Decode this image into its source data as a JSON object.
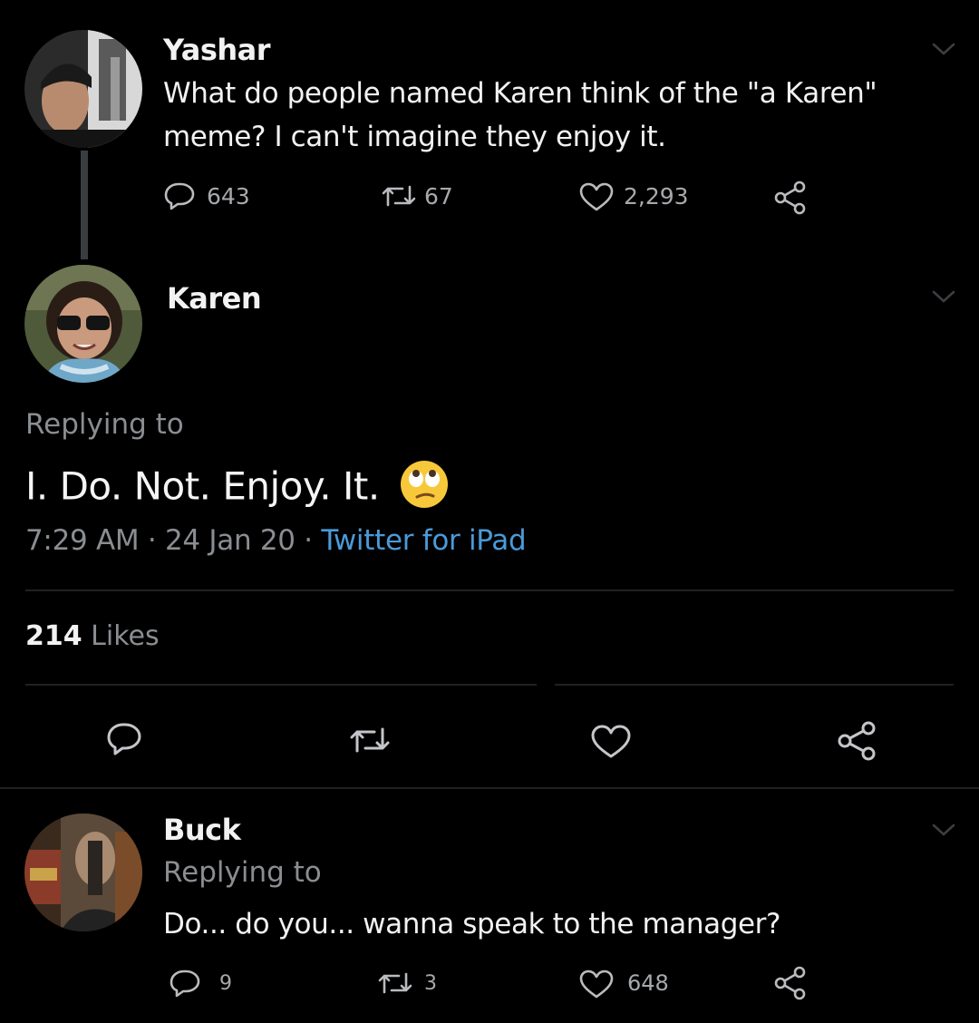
{
  "tweet1": {
    "author": "Yashar",
    "text_line1": "What do people named Karen think of the \"a Karen\"",
    "text_line2": "meme? I can't imagine they enjoy it.",
    "replies": "643",
    "retweets": "67",
    "likes": "2,293"
  },
  "tweet2": {
    "author": "Karen",
    "replying_to": "Replying to",
    "text": "I. Do. Not. Enjoy. It.",
    "time": "7:29 AM",
    "separator": " · ",
    "date": "24 Jan 20",
    "source": "Twitter for iPad",
    "likes_count": "214",
    "likes_label": "Likes"
  },
  "tweet3": {
    "author": "Buck",
    "replying_to": "Replying to",
    "text": "Do... do you... wanna speak to the manager?",
    "replies": "9",
    "retweets": "3",
    "likes": "648"
  },
  "icons": {
    "reply": "reply-icon",
    "retweet": "retweet-icon",
    "like": "heart-icon",
    "share": "share-icon",
    "menu": "chevron-down-icon",
    "emoji": "face-with-rolling-eyes-emoji"
  },
  "colors": {
    "background": "#000000",
    "text": "#f2f2f2",
    "muted": "#8a8d91",
    "link": "#4b9ad8",
    "divider": "#1f2124"
  }
}
